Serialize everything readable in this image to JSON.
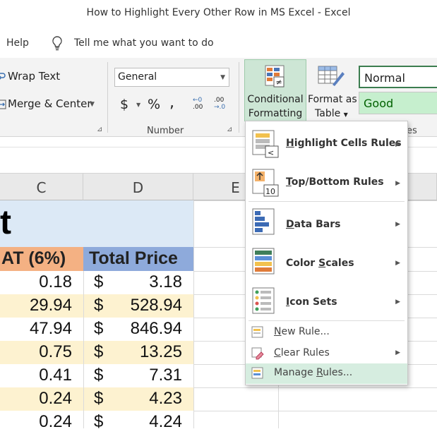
{
  "window": {
    "title": "How to Highlight Every Other Row in MS Excel  -  Excel"
  },
  "menu": {
    "help": "Help",
    "tell_me": "Tell me what you want to do"
  },
  "ribbon": {
    "wrap_text": "Wrap Text",
    "merge_center": "Merge & Center",
    "number_format": "General",
    "currency": "$",
    "percent": "%",
    "comma": ",",
    "inc_decimal_top": "←0",
    "inc_decimal_bottom": ".00",
    "dec_decimal_top": ".00",
    "dec_decimal_bottom": "→.0",
    "number_group_label": "Number",
    "cond_fmt_line1": "Conditional",
    "cond_fmt_line2": "Formatting",
    "format_table_line1": "Format as",
    "format_table_line2": "Table",
    "styles_group_label_fragment": "es",
    "style_normal": "Normal",
    "style_good": "Good"
  },
  "sheet": {
    "columns": [
      "C",
      "D",
      "E"
    ],
    "title_fragment": "t",
    "header_c": "AT (6%)",
    "header_d": "Total Price",
    "rows": [
      {
        "c": "0.18",
        "d_cur": "$",
        "d": "3.18"
      },
      {
        "c": "29.94",
        "d_cur": "$",
        "d": "528.94"
      },
      {
        "c": "47.94",
        "d_cur": "$",
        "d": "846.94"
      },
      {
        "c": "0.75",
        "d_cur": "$",
        "d": "13.25"
      },
      {
        "c": "0.41",
        "d_cur": "$",
        "d": "7.31"
      },
      {
        "c": "0.24",
        "d_cur": "$",
        "d": "4.23"
      },
      {
        "c": "0.24",
        "d_cur": "$",
        "d": "4.24"
      }
    ]
  },
  "cf_menu": {
    "highlight": {
      "pre": "",
      "key": "H",
      "post": "ighlight Cells Rules"
    },
    "topbottom": {
      "pre": "",
      "key": "T",
      "post": "op/Bottom Rules"
    },
    "databars": {
      "pre": "",
      "key": "D",
      "post": "ata Bars"
    },
    "colorscales": {
      "pre": "Color ",
      "key": "S",
      "post": "cales"
    },
    "iconsets": {
      "pre": "",
      "key": "I",
      "post": "con Sets"
    },
    "newrule": {
      "pre": "",
      "key": "N",
      "post": "ew Rule..."
    },
    "clearrules": {
      "pre": "",
      "key": "C",
      "post": "lear Rules"
    },
    "managerules": {
      "pre": "Manage ",
      "key": "R",
      "post": "ules..."
    },
    "topbottom_icon_label": "10",
    "highlight_icon_label": "<"
  },
  "colors": {
    "accent_green": "#217346",
    "cf_button_bg": "#cde6d5",
    "title_row": "#dce9f6",
    "header_c": "#f4b183",
    "header_d": "#8eaadb",
    "band": "#fdf2d0",
    "good_bg": "#c6efce",
    "good_fg": "#006100",
    "hover": "#d6ede0"
  }
}
